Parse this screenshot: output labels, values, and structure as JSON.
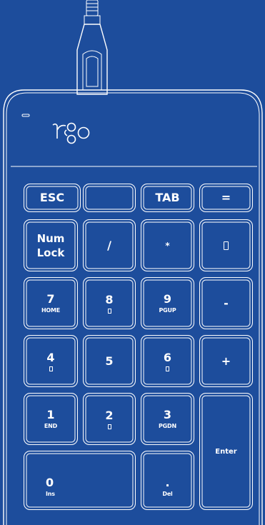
{
  "brand": {
    "logo_text": "r g o"
  },
  "colors": {
    "background": "#1d4d9c",
    "line": "#ffffff"
  },
  "keys": {
    "esc": {
      "label": "ESC"
    },
    "blank": {
      "label": ""
    },
    "tab": {
      "label": "TAB"
    },
    "equals": {
      "label": "="
    },
    "numlock": {
      "line1": "Num",
      "line2": "Lock"
    },
    "slash": {
      "label": "/"
    },
    "star": {
      "label": "*"
    },
    "backspace": {
      "icon": "backspace-bracket-icon"
    },
    "k7": {
      "label": "7",
      "sub": "HOME"
    },
    "k8": {
      "label": "8",
      "icon": "up-arrow-icon"
    },
    "k9": {
      "label": "9",
      "sub": "PGUP"
    },
    "minus": {
      "label": "-"
    },
    "k4": {
      "label": "4",
      "icon": "left-arrow-icon"
    },
    "k5": {
      "label": "5"
    },
    "k6": {
      "label": "6",
      "icon": "right-arrow-icon"
    },
    "plus": {
      "label": "+"
    },
    "k1": {
      "label": "1",
      "sub": "END"
    },
    "k2": {
      "label": "2",
      "icon": "down-arrow-icon"
    },
    "k3": {
      "label": "3",
      "sub": "PGDN"
    },
    "enter": {
      "label": "Enter"
    },
    "k0": {
      "label": "0",
      "sub": "Ins"
    },
    "dot": {
      "label": ".",
      "sub": "Del"
    }
  }
}
